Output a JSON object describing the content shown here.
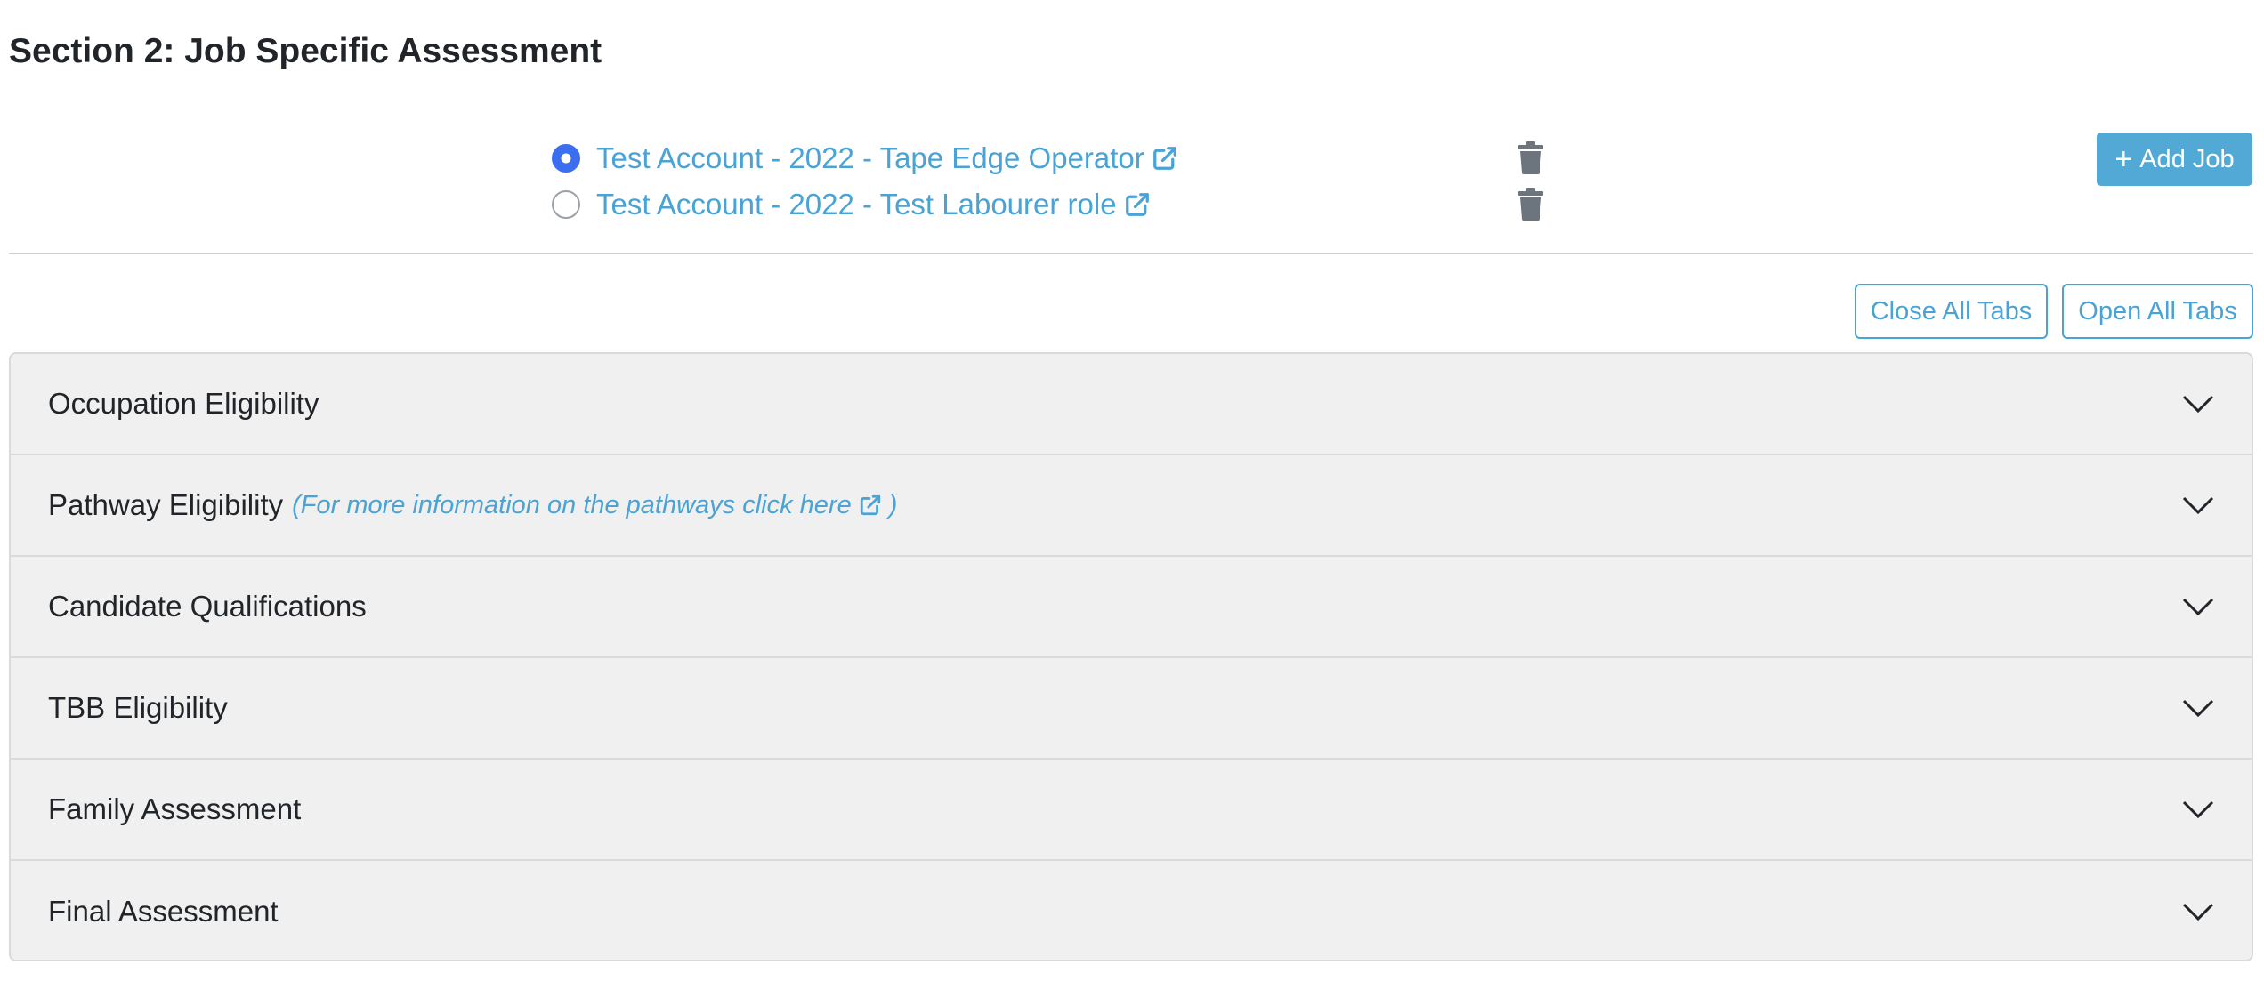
{
  "section": {
    "title": "Section 2: Job Specific Assessment"
  },
  "jobs": [
    {
      "label": "Test Account - 2022 - Tape Edge Operator",
      "selected": true
    },
    {
      "label": "Test Account - 2022 - Test Labourer role",
      "selected": false
    }
  ],
  "buttons": {
    "add_job": "Add Job",
    "close_all": "Close All Tabs",
    "open_all": "Open All Tabs"
  },
  "accordion": {
    "items": [
      {
        "title": "Occupation Eligibility"
      },
      {
        "title": "Pathway Eligibility",
        "note": "(For more information on the pathways click here",
        "note_end": ")"
      },
      {
        "title": "Candidate Qualifications"
      },
      {
        "title": "TBB Eligibility"
      },
      {
        "title": "Family Assessment"
      },
      {
        "title": "Final Assessment"
      }
    ]
  },
  "colors": {
    "link": "#4aa3d4",
    "primary_button": "#52a9d6",
    "radio_selected": "#3b6ff0",
    "accordion_bg": "#f0f0f0",
    "trash_icon": "#6c757d"
  },
  "icons": {
    "external_link": "external-link-icon",
    "trash": "trash-icon",
    "chevron": "chevron-down-icon",
    "plus": "plus-icon"
  }
}
